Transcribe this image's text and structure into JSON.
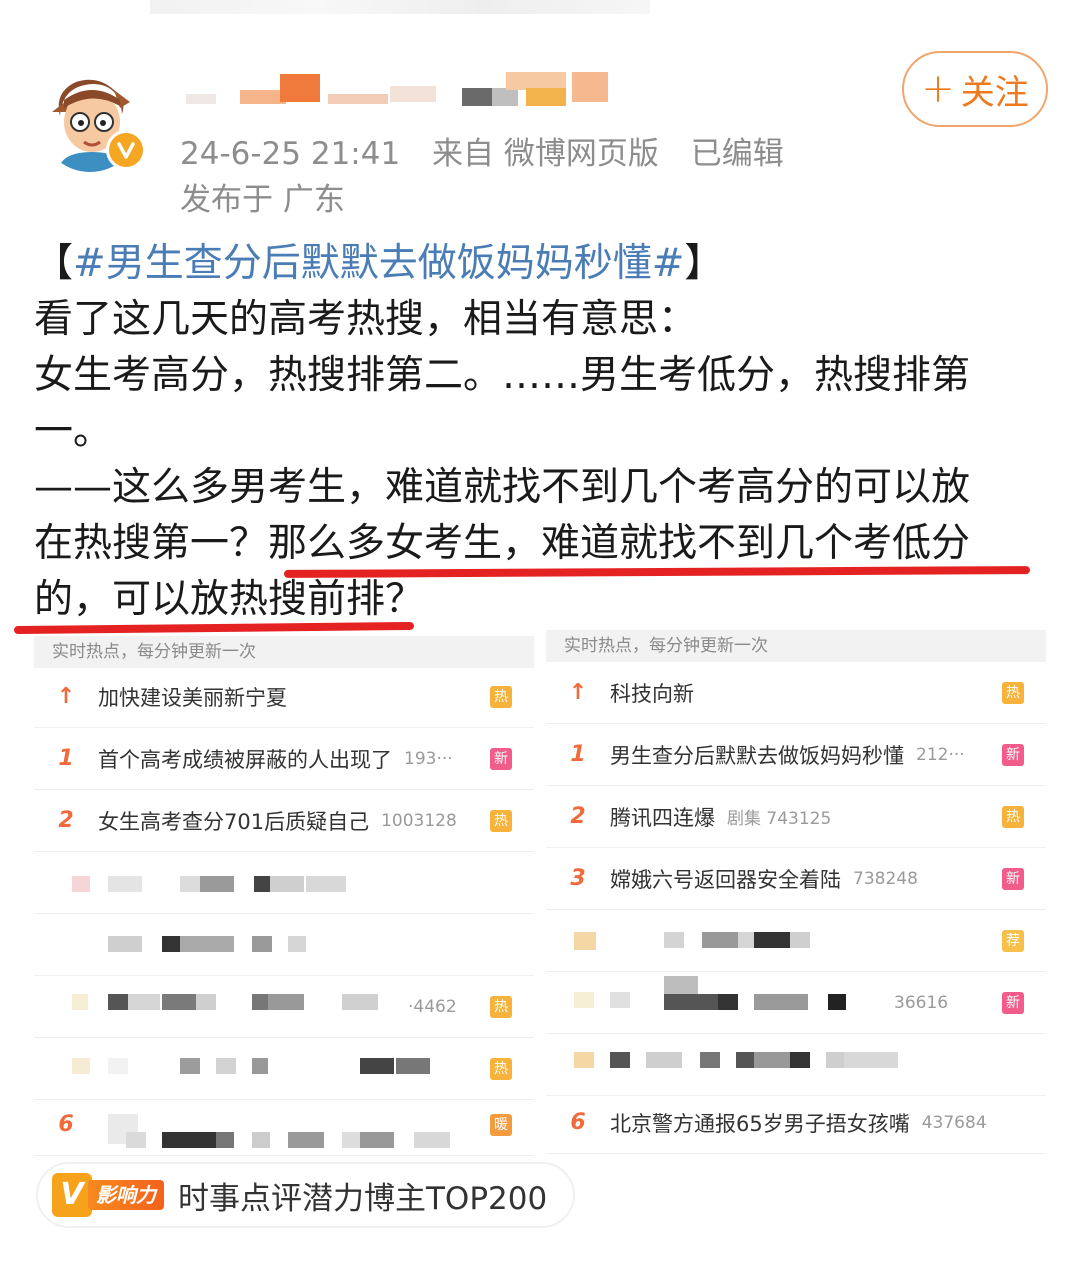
{
  "post": {
    "timestamp": "24-6-25 21:41",
    "source": "来自 微博网页版",
    "edited": "已编辑",
    "location": "发布于 广东",
    "follow_label": "关注",
    "text_lines": [
      {
        "pre": "【",
        "topic": "#男生查分后默默去做饭妈妈秒懂#",
        "post": "】"
      },
      "看了这几天的高考热搜，相当有意思：",
      "女生考高分，热搜排第二。……男生考低分，热搜排第",
      "一。",
      "——这么多男考生，难道就找不到几个考高分的可以放",
      "在热搜第一？那么多女考生，难道就找不到几个考低分",
      "的，可以放热搜前排？"
    ]
  },
  "left_panel": {
    "header": "实时热点，每分钟更新一次",
    "rows": [
      {
        "rank": "↑",
        "title": "加快建设美丽新宁夏",
        "count": "",
        "tag": "热",
        "tag_kind": "hot"
      },
      {
        "rank": "1",
        "title": "首个高考成绩被屏蔽的人出现了",
        "count": "193···",
        "tag": "新",
        "tag_kind": "new"
      },
      {
        "rank": "2",
        "title": "女生高考查分701后质疑自己",
        "count": "1003128",
        "tag": "热",
        "tag_kind": "hot"
      },
      {
        "rank": "",
        "title": "",
        "count": "",
        "tag": "",
        "tag_kind": ""
      },
      {
        "rank": "",
        "title": "",
        "count": "",
        "tag": "",
        "tag_kind": ""
      },
      {
        "rank": "",
        "title": "",
        "count": "·4462",
        "tag": "热",
        "tag_kind": "hot"
      },
      {
        "rank": "",
        "title": "",
        "count": "",
        "tag": "热",
        "tag_kind": "hot"
      },
      {
        "rank": "6",
        "title": "",
        "count": "",
        "tag": "暖",
        "tag_kind": "nuan"
      }
    ]
  },
  "right_panel": {
    "header": "实时热点，每分钟更新一次",
    "rows": [
      {
        "rank": "↑",
        "title": "科技向新",
        "count": "",
        "tag": "热",
        "tag_kind": "hot"
      },
      {
        "rank": "1",
        "title": "男生查分后默默去做饭妈妈秒懂",
        "count": "212···",
        "tag": "新",
        "tag_kind": "new"
      },
      {
        "rank": "2",
        "title": "腾讯四连爆",
        "count": "剧集 743125",
        "tag": "热",
        "tag_kind": "hot"
      },
      {
        "rank": "3",
        "title": "嫦娥六号返回器安全着陆",
        "count": "738248",
        "tag": "新",
        "tag_kind": "new"
      },
      {
        "rank": "",
        "title": "",
        "count": "",
        "tag": "荐",
        "tag_kind": "jian"
      },
      {
        "rank": "",
        "title": "",
        "count": "36616",
        "tag": "新",
        "tag_kind": "new"
      },
      {
        "rank": "",
        "title": "",
        "count": "",
        "tag": "",
        "tag_kind": ""
      },
      {
        "rank": "6",
        "title": "北京警方通报65岁男子捂女孩嘴",
        "count": "437684",
        "tag": "",
        "tag_kind": ""
      }
    ]
  },
  "influence": {
    "v": "V",
    "label": "影响力",
    "text": "时事点评潜力博主TOP200"
  },
  "colors": {
    "accent": "#ef7a1e",
    "topic": "#4a7cb5",
    "underline": "#e52222",
    "meta": "#8d8d8d"
  }
}
